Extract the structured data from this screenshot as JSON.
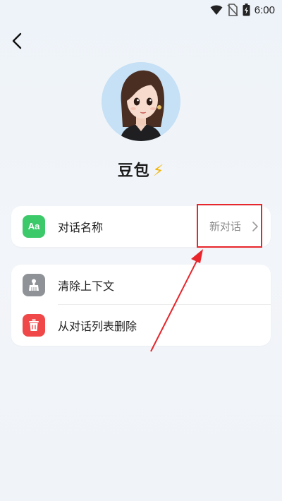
{
  "status_bar": {
    "time": "6:00",
    "icons": [
      "wifi-icon",
      "no-sim-icon",
      "battery-icon"
    ]
  },
  "header": {
    "back_icon": "chevron-left-icon"
  },
  "bot": {
    "name": "豆包",
    "name_suffix_emoji": "⚡",
    "avatar": "cartoon-girl-avatar"
  },
  "settings": {
    "conversation_name": {
      "label": "对话名称",
      "value": "新对话",
      "icon_text": "Aa",
      "icon": "font-icon"
    },
    "clear_context": {
      "label": "清除上下文",
      "icon": "broom-icon"
    },
    "delete_from_list": {
      "label": "从对话列表删除",
      "icon": "trash-icon"
    }
  },
  "colors": {
    "green_icon": "#3cc96a",
    "gray_icon": "#8f9296",
    "red_icon": "#f04848",
    "annotation_red": "#e8262b"
  }
}
